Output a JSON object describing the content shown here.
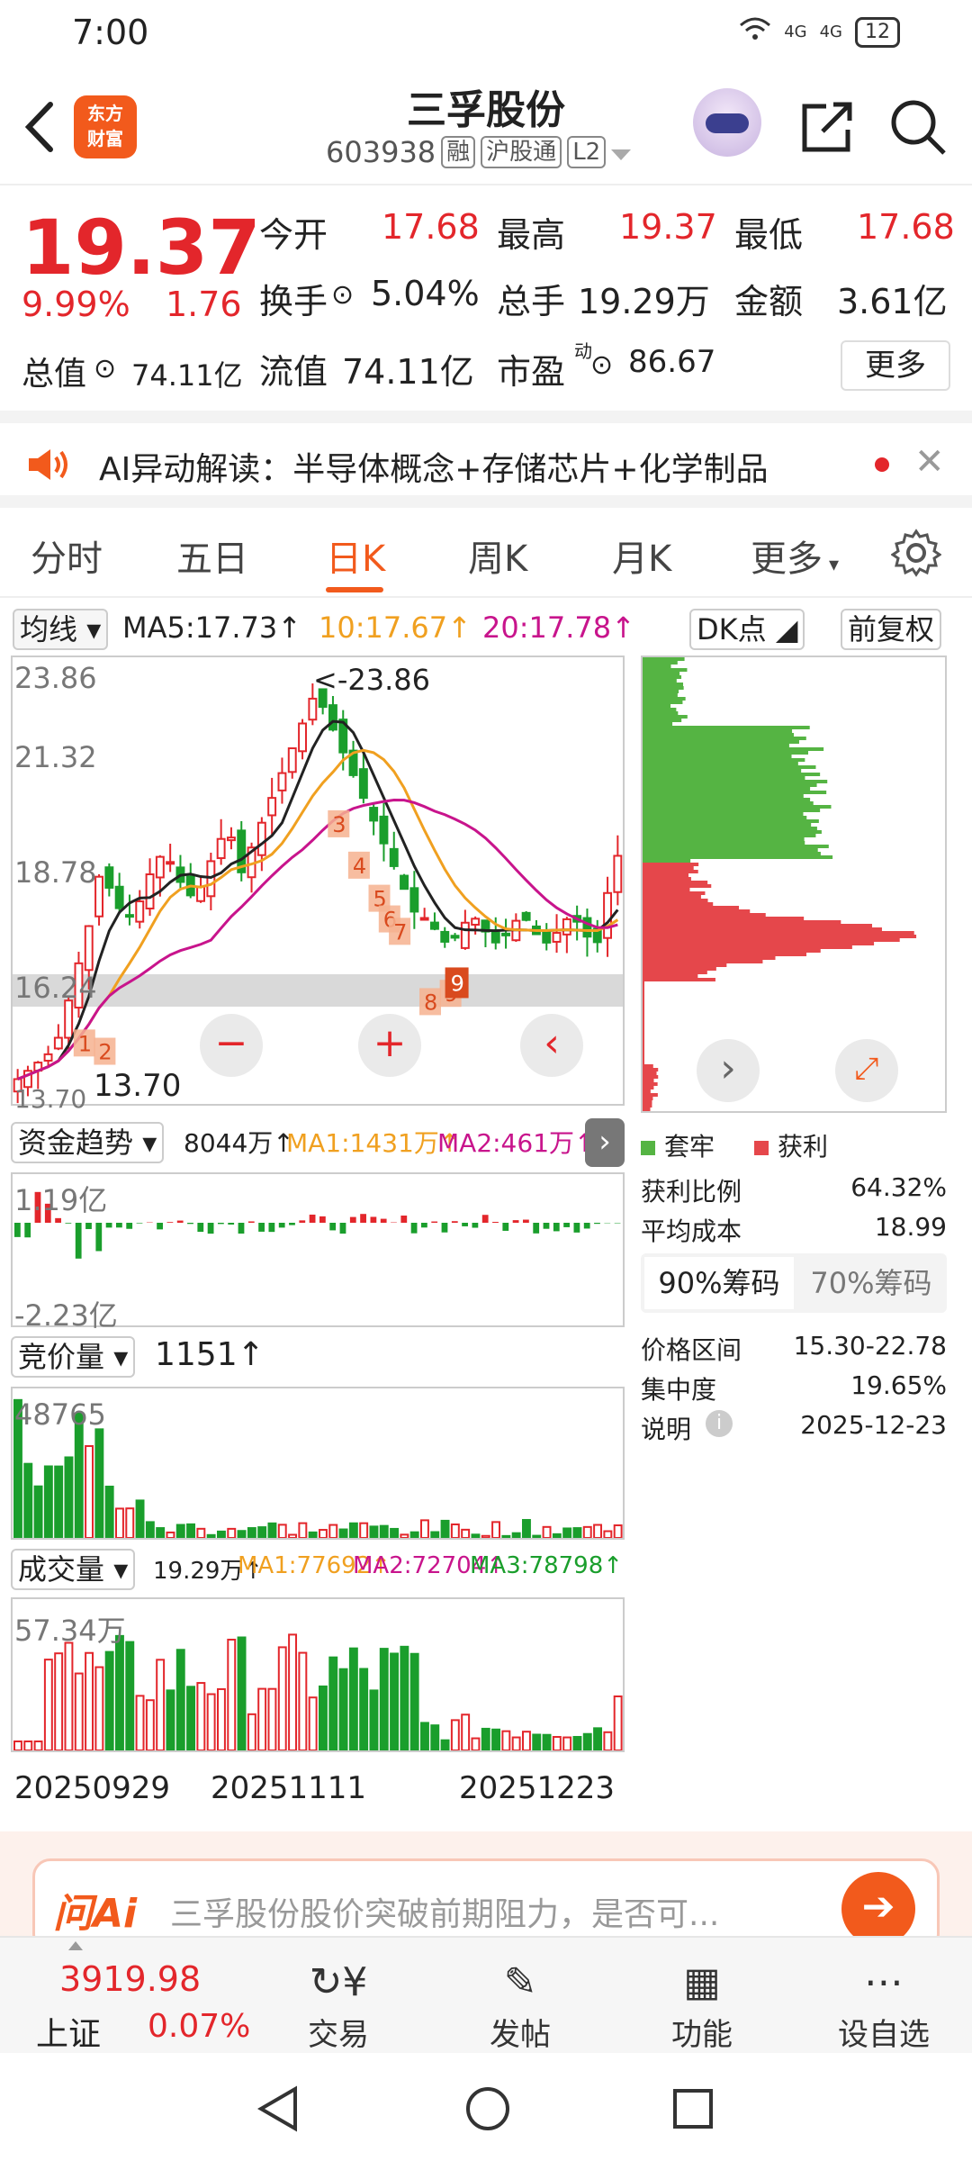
{
  "status": {
    "time": "7:00",
    "battery": "12",
    "net1": "4G",
    "net2": "4G"
  },
  "header": {
    "title": "三孚股份",
    "code": "603938",
    "tags": [
      "融",
      "沪股通",
      "L2"
    ],
    "logo_line1": "东方",
    "logo_line2": "财富"
  },
  "quote": {
    "price": "19.37",
    "change_pct": "9.99%",
    "change": "1.76",
    "open_label": "今开",
    "open": "17.68",
    "high_label": "最高",
    "high": "19.37",
    "low_label": "最低",
    "low": "17.68",
    "turnover_label": "换手",
    "turnover": "5.04%",
    "volume_label": "总手",
    "volume": "19.29万",
    "amount_label": "金额",
    "amount": "3.61亿",
    "mktcap_label": "总值",
    "mktcap": "74.11亿",
    "float_label": "流值",
    "float": "74.11亿",
    "pe_label": "市盈",
    "pe_sup": "动",
    "pe": "86.67",
    "more_label": "更多"
  },
  "ai_banner": {
    "text": "AI异动解读：半导体概念+存储芯片+化学制品"
  },
  "tabs": [
    "分时",
    "五日",
    "日K",
    "周K",
    "月K",
    "更多"
  ],
  "active_tab": "日K",
  "kline": {
    "indicator": "均线",
    "ma5": "MA5:17.73↑",
    "ma10": "10:17.67↑",
    "ma20": "20:17.78↑",
    "dk_label": "DK点",
    "adjust_label": "前复权",
    "y_ticks": [
      "23.86",
      "21.32",
      "18.78",
      "16.24",
      "13.70"
    ],
    "high_mark": "<-23.86",
    "low_mark": "13.70",
    "markers": [
      "1",
      "2",
      "3",
      "4",
      "5",
      "6",
      "7",
      "8",
      "9",
      "9"
    ]
  },
  "funds": {
    "label": "资金趋势",
    "value": "8044万↑",
    "ma1": "MA1:1431万↑",
    "ma2": "MA2:461万↑",
    "top": "1.19亿",
    "bottom": "-2.23亿"
  },
  "auction": {
    "label": "竞价量",
    "value": "1151↑",
    "top": "48765"
  },
  "volume": {
    "label": "成交量",
    "value": "19.29万↑",
    "ma1": "MA1:77692↑",
    "ma2": "MA2:72704↑",
    "ma3": "MA3:78798↑",
    "top": "57.34万"
  },
  "dates": [
    "20250929",
    "20251111",
    "20251223"
  ],
  "chips": {
    "legend_trap": "套牢",
    "legend_profit": "获利",
    "profit_ratio_label": "获利比例",
    "profit_ratio": "64.32%",
    "avg_cost_label": "平均成本",
    "avg_cost": "18.99",
    "seg_on": "90%筹码",
    "seg_off": "70%筹码",
    "range_label": "价格区间",
    "range": "15.30-22.78",
    "conc_label": "集中度",
    "conc": "19.65%",
    "note_label": "说明",
    "note_date": "2025-12-23"
  },
  "ask": {
    "brand": "问Ai",
    "text": "三孚股份股价突破前期阻力，是否可..."
  },
  "bottom_nav": {
    "index_value": "3919.98",
    "index_name": "上证",
    "index_pct": "0.07%",
    "trade": "交易",
    "post": "发帖",
    "func": "功能",
    "watch": "设自选"
  },
  "colors": {
    "up": "#e3262b",
    "down": "#1a9e2c",
    "brand": "#f25a1c",
    "ma_yellow": "#f0a020",
    "ma_magenta": "#c8148c"
  }
}
